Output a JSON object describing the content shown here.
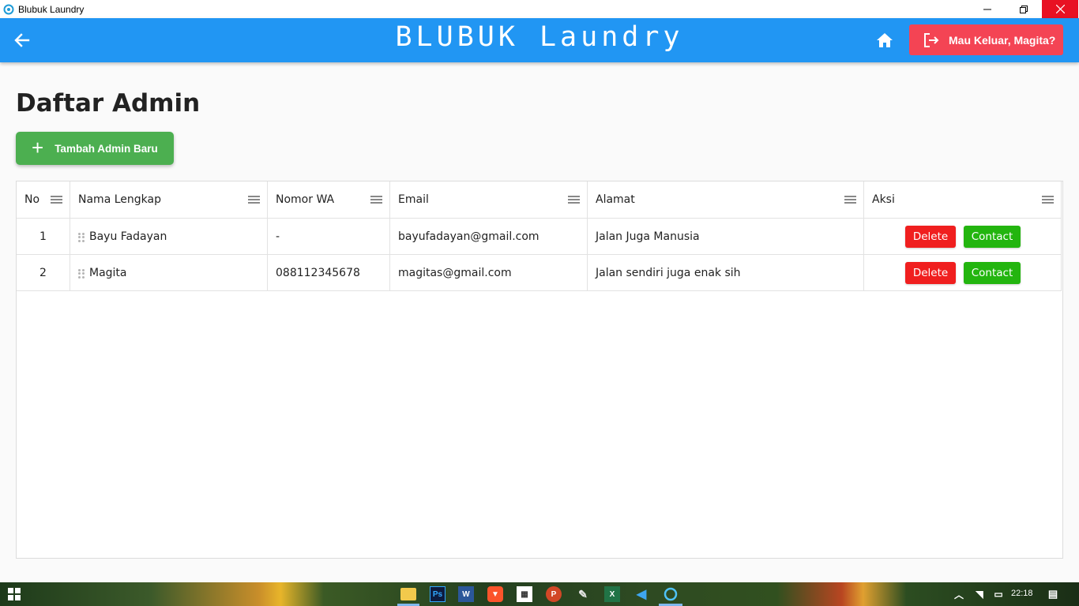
{
  "window": {
    "title": "Blubuk Laundry"
  },
  "appbar": {
    "brand": "BLUBUK Laundry",
    "logout_label": "Mau Keluar, Magita?",
    "color": "#2196f3"
  },
  "page": {
    "title": "Daftar Admin",
    "add_button_label": "Tambah Admin Baru"
  },
  "table": {
    "columns": [
      "No",
      "Nama Lengkap",
      "Nomor WA",
      "Email",
      "Alamat",
      "Aksi"
    ],
    "rows": [
      {
        "no": "1",
        "name": "Bayu Fadayan",
        "wa": "-",
        "email": "bayufadayan@gmail.com",
        "address": "Jalan Juga Manusia",
        "delete": "Delete",
        "contact": "Contact"
      },
      {
        "no": "2",
        "name": "Magita",
        "wa": "088112345678",
        "email": "magitas@gmail.com",
        "address": "Jalan sendiri juga enak sih",
        "delete": "Delete",
        "contact": "Contact"
      }
    ]
  },
  "taskbar": {
    "apps": [
      "windows-start",
      "file-explorer",
      "photoshop",
      "word",
      "brave",
      "microsoft-store",
      "powerpoint",
      "paint",
      "excel",
      "vscode",
      "flutter-app"
    ],
    "clock": "22:18"
  }
}
